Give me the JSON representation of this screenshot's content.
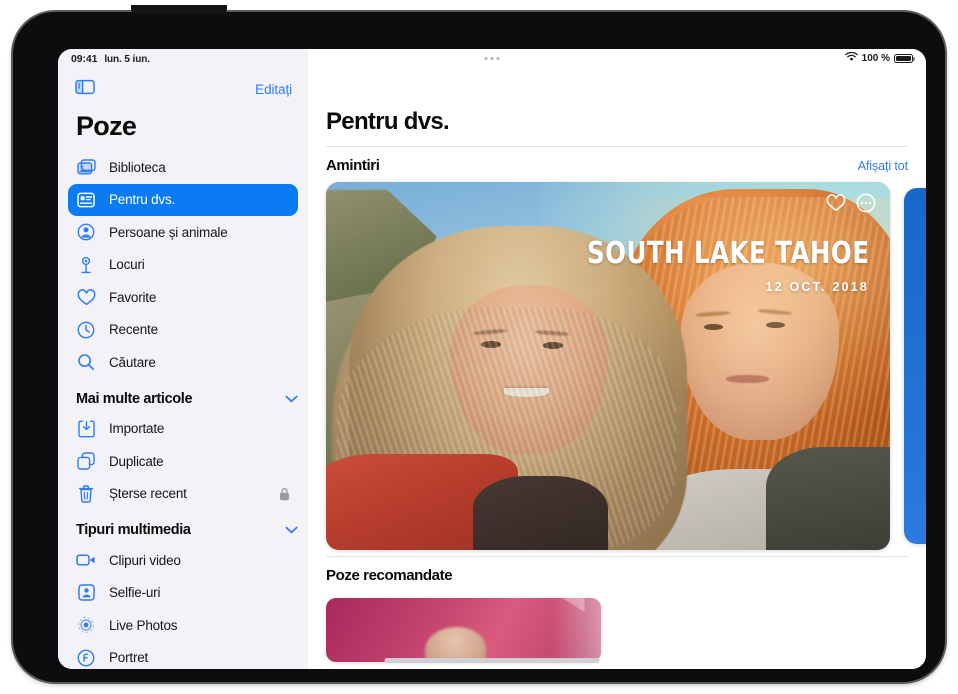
{
  "status_bar": {
    "time": "09:41",
    "date": "lun. 5 iun.",
    "battery_percent": "100 %",
    "wifi_icon": "wifi-icon",
    "battery_icon": "battery-full-icon",
    "grabber_icon": "multitasking-dots-icon"
  },
  "sidebar": {
    "toolbar": {
      "sidebar_toggle_icon": "sidebar-toggle-icon",
      "edit_label": "Editați"
    },
    "title": "Poze",
    "primary_items": [
      {
        "label": "Biblioteca",
        "icon": "photo-stack-icon",
        "selected": false
      },
      {
        "label": "Pentru dvs.",
        "icon": "for-you-card-icon",
        "selected": true
      },
      {
        "label": "Persoane și animale",
        "icon": "person-circle-icon",
        "selected": false
      },
      {
        "label": "Locuri",
        "icon": "map-pin-icon",
        "selected": false
      },
      {
        "label": "Favorite",
        "icon": "heart-icon",
        "selected": false
      },
      {
        "label": "Recente",
        "icon": "clock-icon",
        "selected": false
      },
      {
        "label": "Căutare",
        "icon": "search-icon",
        "selected": false
      }
    ],
    "sections": [
      {
        "title": "Mai multe articole",
        "chevron_icon": "chevron-down-icon",
        "items": [
          {
            "label": "Importate",
            "icon": "import-tray-icon",
            "trailing_icon": ""
          },
          {
            "label": "Duplicate",
            "icon": "duplicate-squares-icon",
            "trailing_icon": ""
          },
          {
            "label": "Șterse recent",
            "icon": "trash-icon",
            "trailing_icon": "lock-icon"
          }
        ]
      },
      {
        "title": "Tipuri multimedia",
        "chevron_icon": "chevron-down-icon",
        "items": [
          {
            "label": "Clipuri video",
            "icon": "video-camera-icon",
            "trailing_icon": ""
          },
          {
            "label": "Selfie-uri",
            "icon": "selfie-person-icon",
            "trailing_icon": ""
          },
          {
            "label": "Live Photos",
            "icon": "live-photo-icon",
            "trailing_icon": ""
          },
          {
            "label": "Portret",
            "icon": "portrait-f-icon",
            "trailing_icon": ""
          }
        ]
      }
    ]
  },
  "main": {
    "page_title": "Pentru dvs.",
    "memories": {
      "section_title": "Amintiri",
      "show_all_label": "Afișați tot",
      "card": {
        "title": "SOUTH LAKE TAHOE",
        "date": "12 OCT. 2018",
        "favorite_icon": "heart-outline-icon",
        "more_icon": "ellipsis-circle-icon"
      }
    },
    "recommended": {
      "section_title": "Poze recomandate"
    }
  },
  "colors": {
    "accent_blue": "#2f7cf6",
    "selected_blue": "#0a7bf2",
    "sidebar_background": "#f2f2f7",
    "content_background": "#ffffff",
    "text_primary": "#0b0b0c",
    "separator": "#e2e2e6"
  }
}
